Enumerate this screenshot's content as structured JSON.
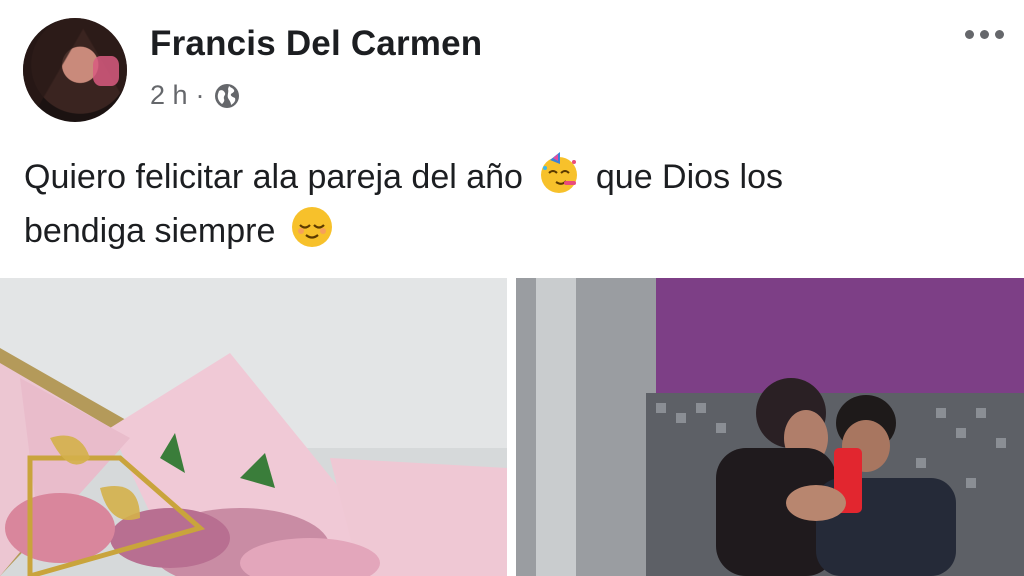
{
  "post": {
    "author": "Francis Del Carmen",
    "time": "2 h",
    "separator": "·",
    "line1": "Quiero felicitar ala pareja del año",
    "line1b": "que Dios los",
    "line2": "bendiga siempre"
  },
  "icons": {
    "audience": "globe-icon",
    "menu": "more-options-icon",
    "emoji1": "partying-face-emoji",
    "emoji2": "relieved-face-emoji"
  },
  "photos": [
    "flower-bouquet-photo",
    "couple-mirror-selfie-photo"
  ]
}
